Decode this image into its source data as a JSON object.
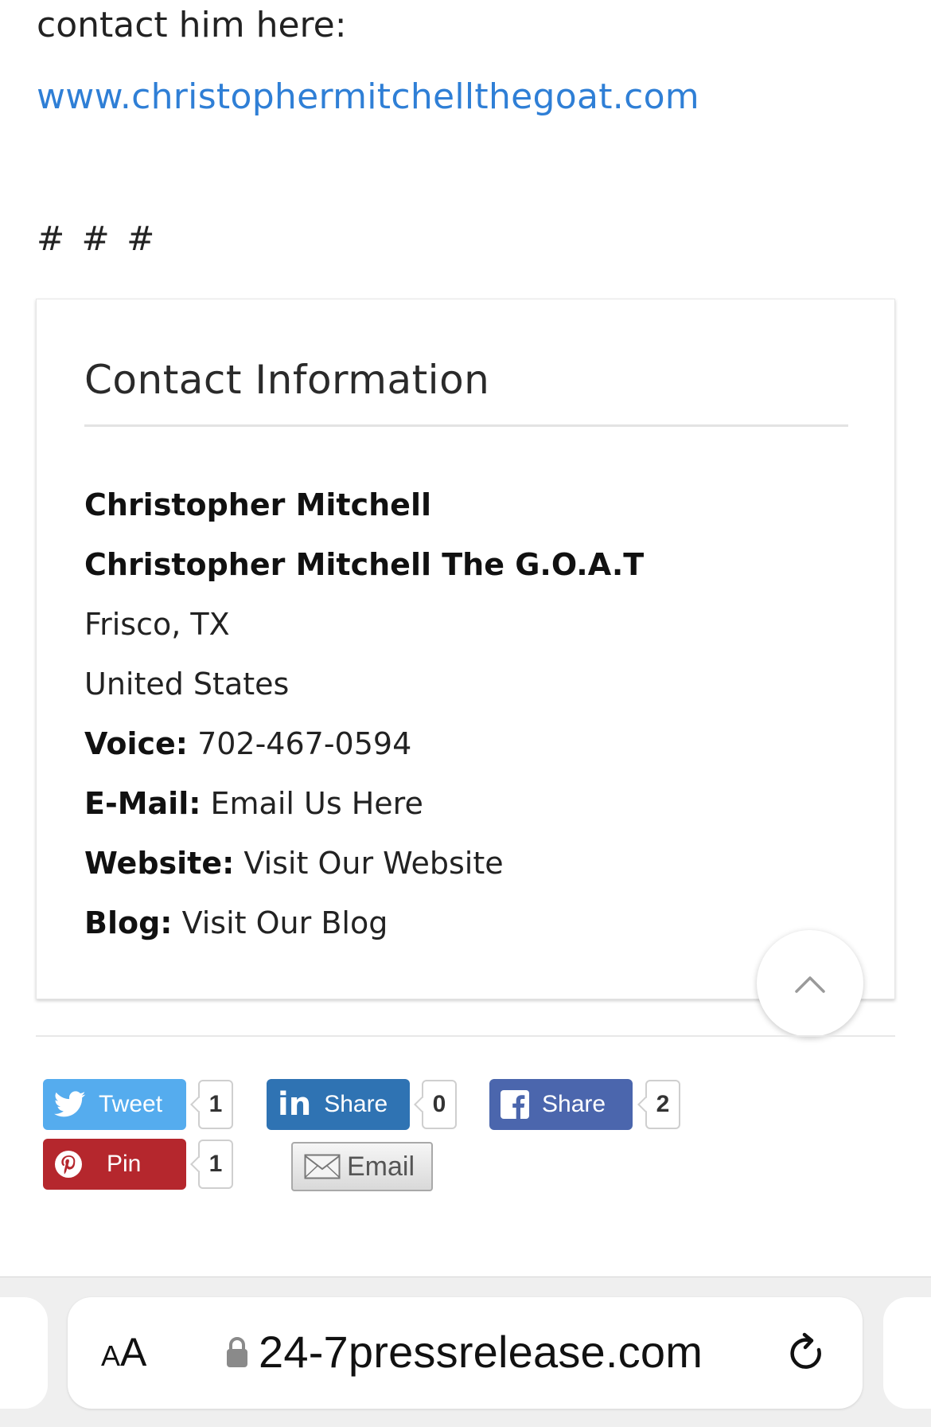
{
  "article": {
    "intro_text": "contact him here:",
    "website_link": "www.christophermitchellthegoat.com",
    "end_marks": "# # #"
  },
  "contact": {
    "title": "Contact Information",
    "name": "Christopher Mitchell",
    "company": "Christopher Mitchell The G.O.A.T",
    "city": "Frisco, TX",
    "country": "United States",
    "voice_label": "Voice:",
    "voice_value": "702-467-0594",
    "email_label": "E-Mail:",
    "email_value": "Email Us Here",
    "website_label": "Website:",
    "website_value": "Visit Our Website",
    "blog_label": "Blog:",
    "blog_value": "Visit Our Blog"
  },
  "share": {
    "tweet_label": "Tweet",
    "tweet_count": "1",
    "linkedin_label": "Share",
    "linkedin_count": "0",
    "facebook_label": "Share",
    "facebook_count": "2",
    "pin_label": "Pin",
    "pin_count": "1",
    "email_label": "Email",
    "colors": {
      "twitter": "#55acee",
      "linkedin": "#2f73b3",
      "facebook": "#4b66ad",
      "pinterest": "#b5272d"
    }
  },
  "browser": {
    "text_size_small": "A",
    "text_size_big": "A",
    "url": "24-7pressrelease.com",
    "icons": [
      "lock-icon",
      "reload-icon",
      "chevron-up-icon"
    ]
  }
}
